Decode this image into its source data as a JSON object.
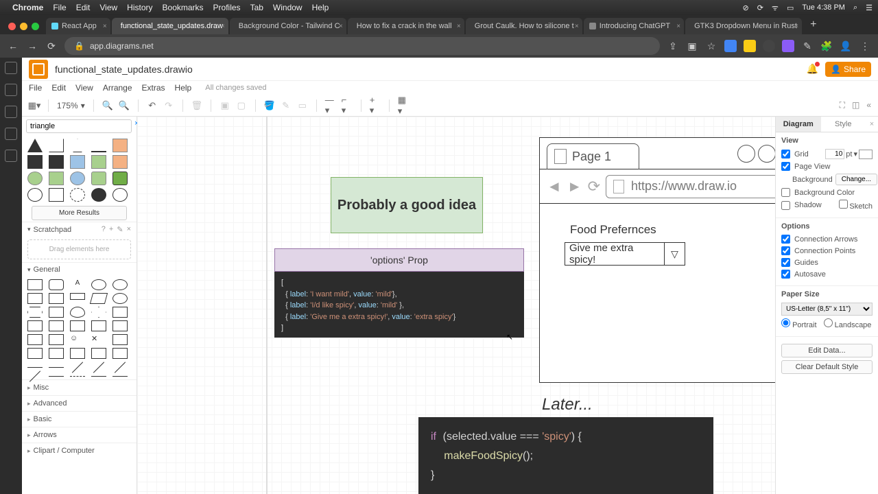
{
  "mac": {
    "app": "Chrome",
    "menus": [
      "File",
      "Edit",
      "View",
      "History",
      "Bookmarks",
      "Profiles",
      "Tab",
      "Window",
      "Help"
    ],
    "clock": "Tue 4:38 PM"
  },
  "tabs": [
    {
      "label": "React App",
      "active": false
    },
    {
      "label": "functional_state_updates.draw",
      "active": true
    },
    {
      "label": "Background Color - Tailwind C",
      "active": false
    },
    {
      "label": "How to fix a crack in the wall",
      "active": false
    },
    {
      "label": "Grout Caulk. How to silicone t",
      "active": false
    },
    {
      "label": "Introducing ChatGPT",
      "active": false
    },
    {
      "label": "GTK3 Dropdown Menu in Rust",
      "active": false
    }
  ],
  "omnibox": "app.diagrams.net",
  "doc": {
    "title": "functional_state_updates.drawio",
    "menus": [
      "File",
      "Edit",
      "View",
      "Arrange",
      "Extras",
      "Help"
    ],
    "saved": "All changes saved",
    "share": "Share",
    "zoom": "175%"
  },
  "search": {
    "value": "triangle",
    "more": "More Results"
  },
  "scratch": {
    "hdr": "Scratchpad",
    "drop": "Drag elements here"
  },
  "cats": [
    "General",
    "Misc",
    "Advanced",
    "Basic",
    "Arrows",
    "Clipart / Computer"
  ],
  "canvas": {
    "green": "Probably a good idea",
    "opt_hdr": "'options' Prop",
    "code1_l1": "[",
    "code1_l2": "  { label: 'I want mild', value: 'mild'},",
    "code1_l3": "  { label: 'I/d like spicy', value: 'mild' },",
    "code1_l4": "  { label: 'Give me a extra spicy!', value: 'extra spicy'}",
    "code1_l5": "]",
    "mock_tab": "Page 1",
    "mock_url": "https://www.draw.io",
    "mock_lbl": "Food Prefernces",
    "mock_sel": "Give me extra spicy!",
    "later": "Later...",
    "code2_l1": "if (selected.value === 'spicy') {",
    "code2_l2": "  makeFoodSpicy();",
    "code2_l3": "}"
  },
  "right": {
    "tab1": "Diagram",
    "tab2": "Style",
    "view": "View",
    "grid": "Grid",
    "grid_v": "10",
    "grid_u": "pt",
    "pageview": "Page View",
    "bg": "Background",
    "change": "Change...",
    "bgcolor": "Background Color",
    "shadow": "Shadow",
    "sketch": "Sketch",
    "options": "Options",
    "ca": "Connection Arrows",
    "cp": "Connection Points",
    "gu": "Guides",
    "as": "Autosave",
    "ps": "Paper Size",
    "ps_v": "US-Letter (8,5\" x 11\")",
    "portrait": "Portrait",
    "landscape": "Landscape",
    "edit": "Edit Data...",
    "clear": "Clear Default Style"
  }
}
